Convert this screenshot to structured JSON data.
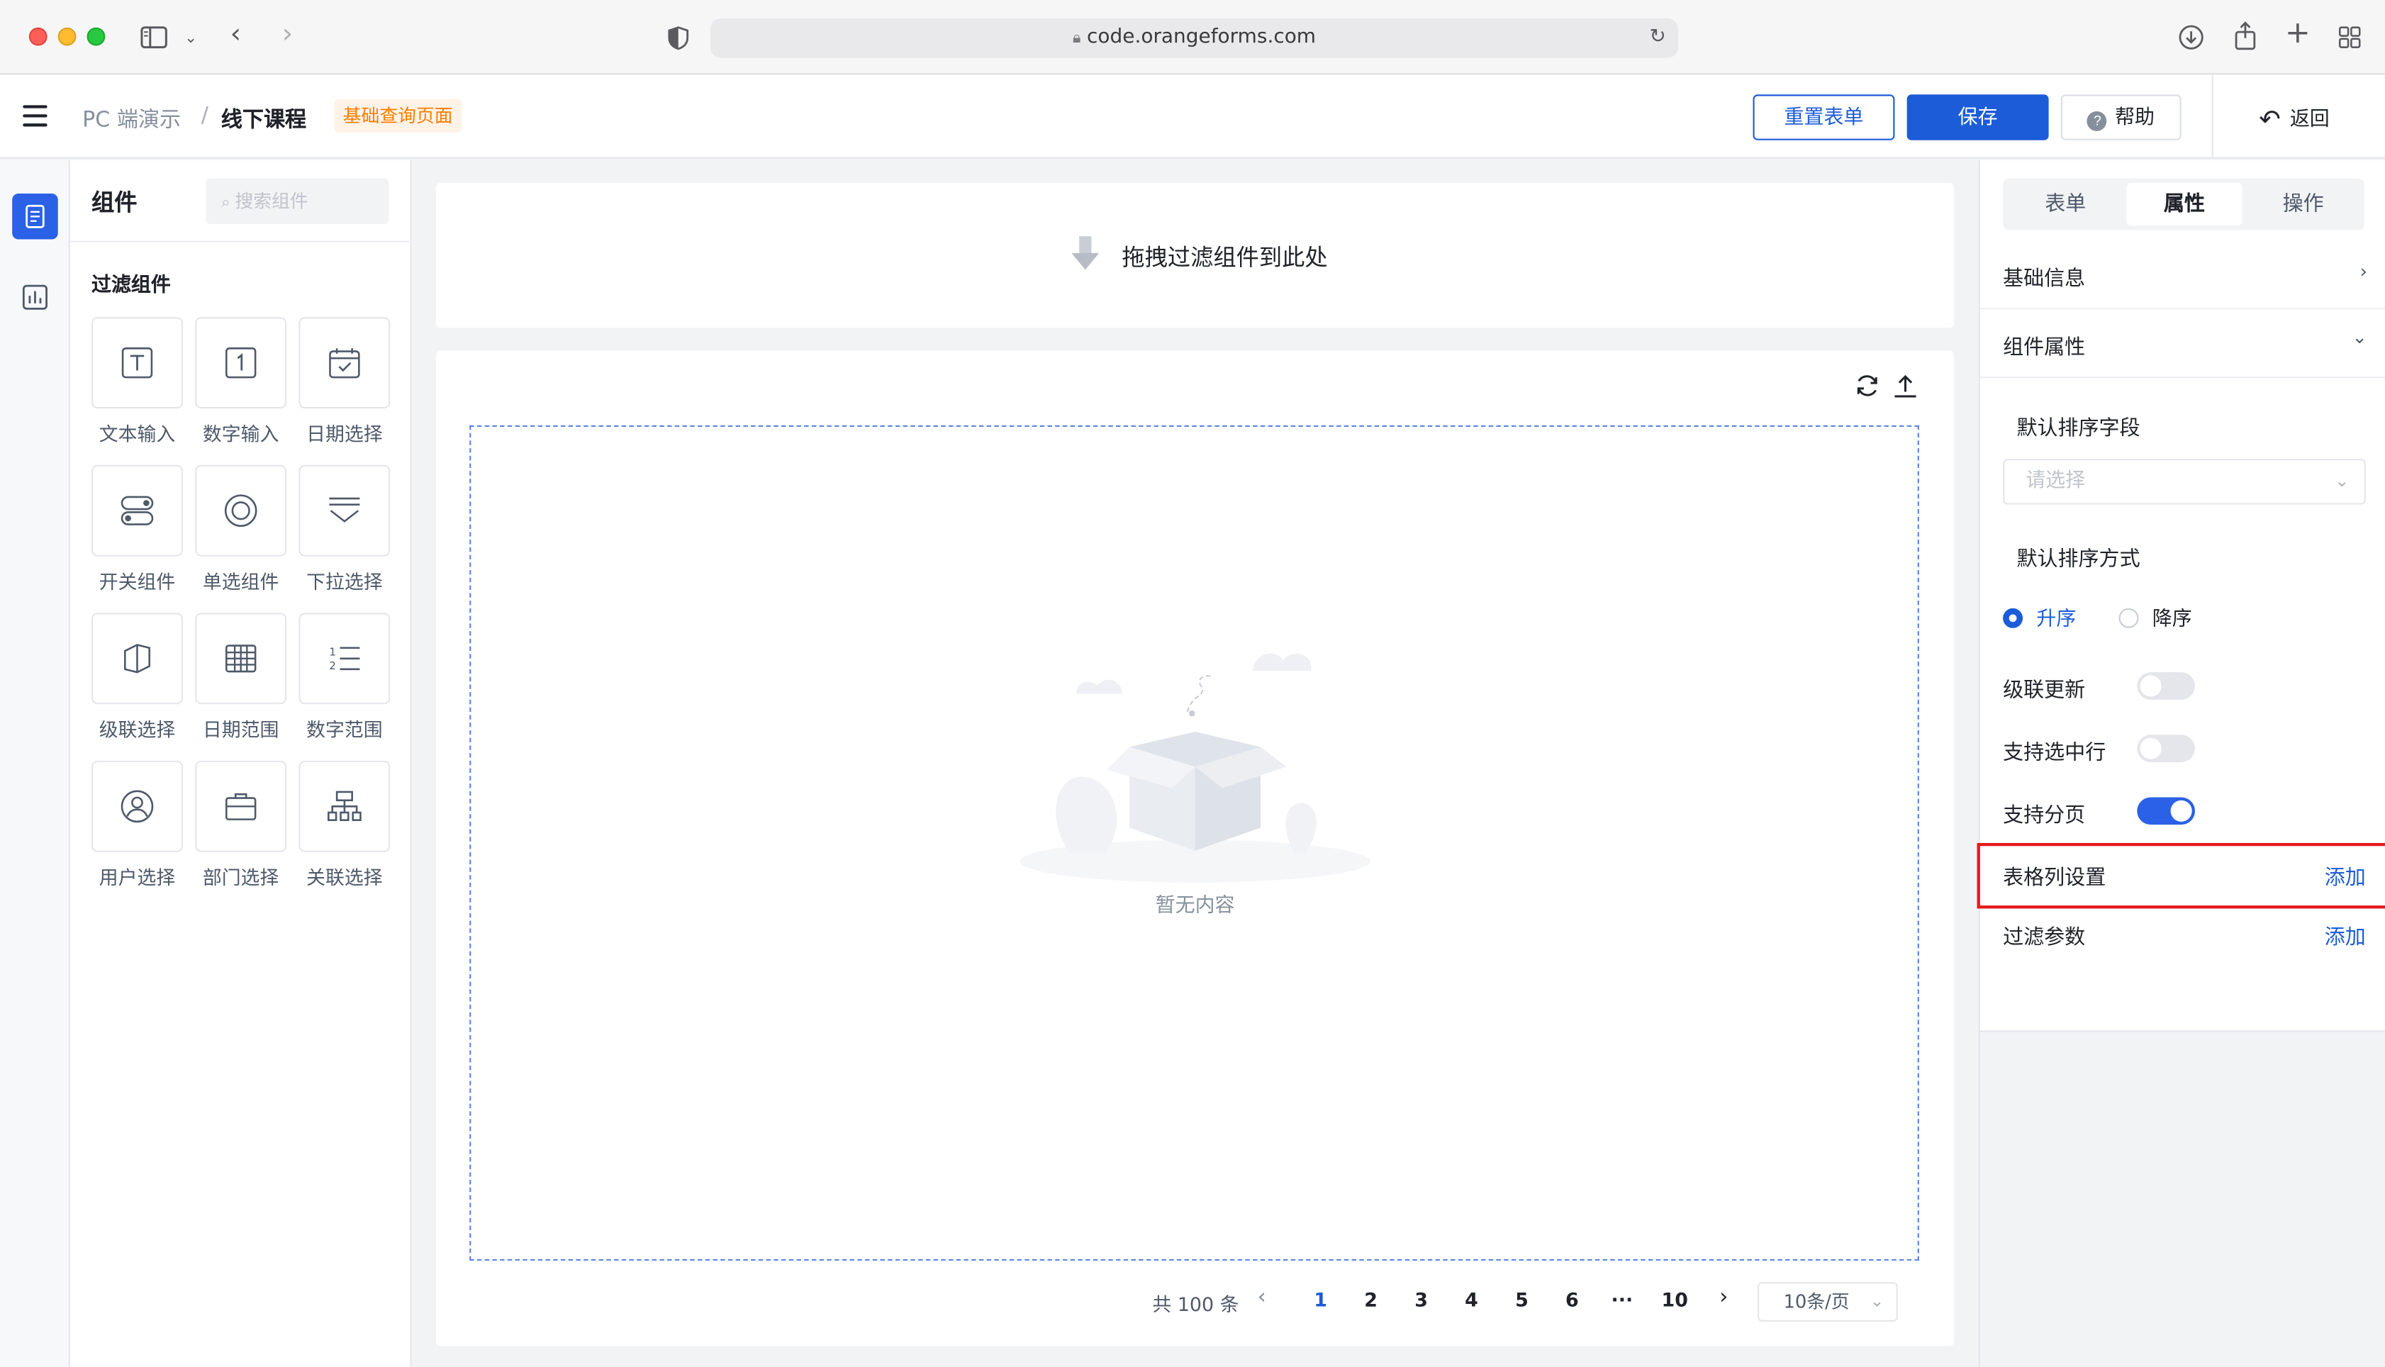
{
  "browser": {
    "url": "code.orangeforms.com"
  },
  "header": {
    "breadcrumb": [
      "PC 端演示",
      "/",
      "线下课程"
    ],
    "tag": "基础查询页面",
    "reset_label": "重置表单",
    "save_label": "保存",
    "help_label": "帮助",
    "back_label": "返回"
  },
  "components": {
    "title": "组件",
    "search_placeholder": "搜索组件",
    "group_title": "过滤组件",
    "items": [
      {
        "label": "文本输入",
        "icon": "text-input-icon"
      },
      {
        "label": "数字输入",
        "icon": "number-input-icon"
      },
      {
        "label": "日期选择",
        "icon": "date-picker-icon"
      },
      {
        "label": "开关组件",
        "icon": "switch-icon"
      },
      {
        "label": "单选组件",
        "icon": "radio-icon"
      },
      {
        "label": "下拉选择",
        "icon": "dropdown-icon"
      },
      {
        "label": "级联选择",
        "icon": "cascader-icon"
      },
      {
        "label": "日期范围",
        "icon": "date-range-icon"
      },
      {
        "label": "数字范围",
        "icon": "number-range-icon"
      },
      {
        "label": "用户选择",
        "icon": "user-select-icon"
      },
      {
        "label": "部门选择",
        "icon": "department-select-icon"
      },
      {
        "label": "关联选择",
        "icon": "relation-select-icon"
      }
    ]
  },
  "canvas": {
    "drop_hint": "拖拽过滤组件到此处",
    "empty_text": "暂无内容",
    "pagination": {
      "total": "共 100 条",
      "pages": [
        "1",
        "2",
        "3",
        "4",
        "5",
        "6",
        "···",
        "10"
      ],
      "current": "1",
      "page_size": "10条/页"
    }
  },
  "props": {
    "tabs": [
      "表单",
      "属性",
      "操作"
    ],
    "active_tab": "属性",
    "basic_info": "基础信息",
    "component_props": "组件属性",
    "sort_field_label": "默认排序字段",
    "sort_field_placeholder": "请选择",
    "sort_order_label": "默认排序方式",
    "sort_asc": "升序",
    "sort_desc": "降序",
    "cascade_update": "级联更新",
    "select_row": "支持选中行",
    "pagination": "支持分页",
    "column_settings": "表格列设置",
    "filter_params": "过滤参数",
    "add_label": "添加",
    "cascade_update_on": false,
    "select_row_on": false,
    "pagination_on": true
  },
  "colors": {
    "primary": "#1d5cd9",
    "tag_orange": "#ff7d00",
    "highlight_red": "#e3191b"
  }
}
